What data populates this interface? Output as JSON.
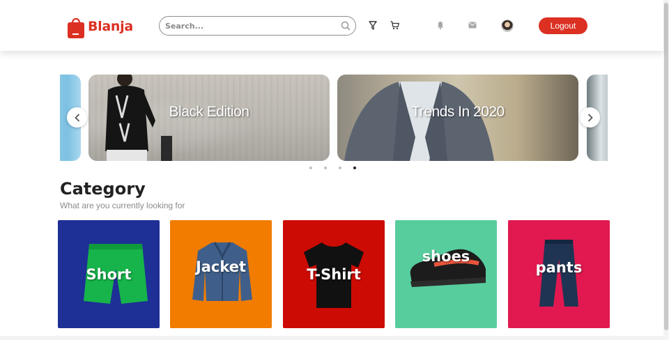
{
  "brand": {
    "name": "Blanja",
    "color": "#db3022"
  },
  "search": {
    "placeholder": "Search..."
  },
  "header_icons": [
    "filter-icon",
    "cart-icon",
    "bell-icon",
    "mail-icon",
    "user-avatar"
  ],
  "logout_label": "Logout",
  "carousel": {
    "slides": [
      {
        "title": ""
      },
      {
        "title": "Black Edition"
      },
      {
        "title": "Trends In 2020"
      },
      {
        "title": ""
      }
    ],
    "dot_count": 4,
    "active_dot": 4
  },
  "category": {
    "title": "Category",
    "subtitle": "What are you currently looking for",
    "items": [
      {
        "label": "Short",
        "color": "#1e2f96"
      },
      {
        "label": "Jacket",
        "color": "#f17c00"
      },
      {
        "label": "T-Shirt",
        "color": "#cc0b04"
      },
      {
        "label": "shoes",
        "color": "#57cd9e"
      },
      {
        "label": "pants",
        "color": "#e11950"
      }
    ]
  }
}
